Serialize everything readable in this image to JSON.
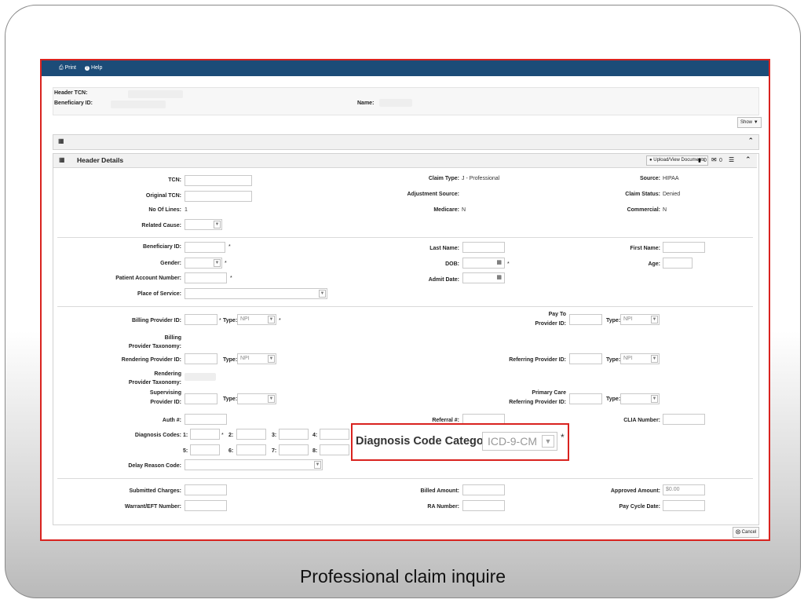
{
  "toolbar": {
    "print": "Print",
    "help": "Help"
  },
  "claim_info": {
    "header_tcn": "Header TCN:",
    "beneficiary_id": "Beneficiary ID:",
    "name": "Name:"
  },
  "show_button": "Show",
  "header_details": {
    "title": "Header Details",
    "upload_button": "Upload/View Documents",
    "doc_count": "0",
    "mail_count": "0"
  },
  "labels": {
    "tcn": "TCN:",
    "original_tcn": "Original TCN:",
    "no_of_lines": "No Of Lines:",
    "related_cause": "Related Cause:",
    "claim_type": "Claim Type:",
    "adjustment_source": "Adjustment Source:",
    "medicare": "Medicare:",
    "source": "Source:",
    "claim_status": "Claim Status:",
    "commercial": "Commercial:",
    "beneficiary_id": "Beneficiary ID:",
    "gender": "Gender:",
    "patient_account_number": "Patient Account Number:",
    "place_of_service": "Place of Service:",
    "last_name": "Last Name:",
    "dob": "DOB:",
    "admit_date": "Admit Date:",
    "first_name": "First Name:",
    "age": "Age:",
    "billing_provider_id": "Billing Provider ID:",
    "type": "Type:",
    "pay_to_1": "Pay To",
    "pay_to_2": "Provider ID:",
    "billing_tax_1": "Billing",
    "billing_tax_2": "Provider Taxonomy:",
    "rendering_provider_id": "Rendering Provider ID:",
    "referring_provider_id": "Referring Provider ID:",
    "rendering_tax_1": "Rendering",
    "rendering_tax_2": "Provider Taxonomy:",
    "supervising_1": "Supervising",
    "supervising_2": "Provider ID:",
    "primary_care_1": "Primary Care",
    "primary_care_2": "Referring Provider ID:",
    "auth": "Auth #:",
    "referral": "Referral #:",
    "clia": "CLIA Number:",
    "diagnosis_codes": "Diagnosis Codes:",
    "dx1": "1:",
    "dx2": "2:",
    "dx3": "3:",
    "dx4": "4:",
    "dx5": "5:",
    "dx6": "6:",
    "dx7": "7:",
    "dx8": "8:",
    "delay_reason_code": "Delay Reason Code:",
    "submitted_charges": "Submitted Charges:",
    "warrant_eft": "Warrant/EFT Number:",
    "billed_amount": "Billed Amount:",
    "ra_number": "RA Number:",
    "approved_amount": "Approved Amount:",
    "pay_cycle_date": "Pay Cycle Date:"
  },
  "values": {
    "no_of_lines": "1",
    "claim_type": "J - Professional",
    "medicare": "N",
    "source": "HIPAA",
    "claim_status": "Denied",
    "commercial": "N",
    "type_npi": "NPI",
    "approved_amount": "$0.00"
  },
  "diagnosis_category": {
    "label": "Diagnosis Code Category:",
    "value": "ICD-9-CM",
    "required": "*"
  },
  "required_mark": "*",
  "cancel_button": "Cancel",
  "caption": "Professional claim inquire"
}
